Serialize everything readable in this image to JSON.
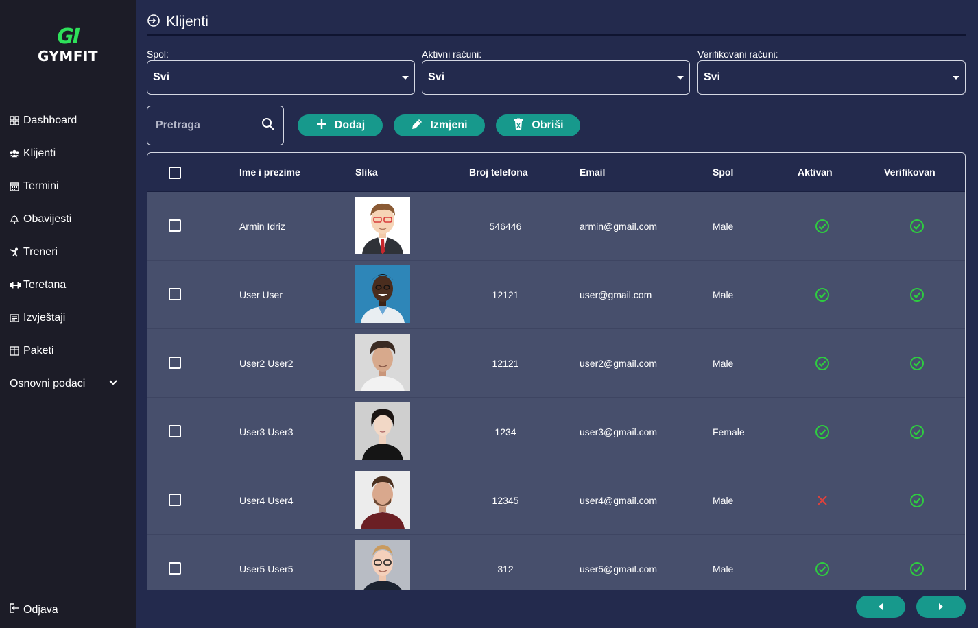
{
  "app": {
    "logo_mark": "GI",
    "logo_text": "GYMFIT"
  },
  "sidebar": {
    "items": [
      {
        "label": "Dashboard",
        "icon": "dashboard-icon"
      },
      {
        "label": "Klijenti",
        "icon": "users-icon"
      },
      {
        "label": "Termini",
        "icon": "calendar-icon"
      },
      {
        "label": "Obavijesti",
        "icon": "bell-icon"
      },
      {
        "label": "Treneri",
        "icon": "trainer-icon"
      },
      {
        "label": "Teretana",
        "icon": "dumbbell-icon"
      },
      {
        "label": "Izvještaji",
        "icon": "report-icon"
      },
      {
        "label": "Paketi",
        "icon": "package-icon"
      }
    ],
    "group_label": "Osnovni podaci",
    "logout_label": "Odjava"
  },
  "header": {
    "title": "Klijenti"
  },
  "filters": [
    {
      "label": "Spol:",
      "value": "Svi"
    },
    {
      "label": "Aktivni računi:",
      "value": "Svi"
    },
    {
      "label": "Verifikovani računi:",
      "value": "Svi"
    }
  ],
  "search": {
    "placeholder": "Pretraga"
  },
  "actions": {
    "add_label": "Dodaj",
    "edit_label": "Izmjeni",
    "delete_label": "Obriši"
  },
  "table": {
    "columns": [
      "Ime i prezime",
      "Slika",
      "Broj telefona",
      "Email",
      "Spol",
      "Aktivan",
      "Verifikovan"
    ],
    "rows": [
      {
        "name": "Armin Idriz",
        "phone": "546446",
        "email": "armin@gmail.com",
        "gender": "Male",
        "active": true,
        "verified": true
      },
      {
        "name": "User User",
        "phone": "12121",
        "email": "user@gmail.com",
        "gender": "Male",
        "active": true,
        "verified": true
      },
      {
        "name": "User2 User2",
        "phone": "12121",
        "email": "user2@gmail.com",
        "gender": "Male",
        "active": true,
        "verified": true
      },
      {
        "name": "User3 User3",
        "phone": "1234",
        "email": "user3@gmail.com",
        "gender": "Female",
        "active": true,
        "verified": true
      },
      {
        "name": "User4 User4",
        "phone": "12345",
        "email": "user4@gmail.com",
        "gender": "Male",
        "active": false,
        "verified": true
      },
      {
        "name": "User5 User5",
        "phone": "312",
        "email": "user5@gmail.com",
        "gender": "Male",
        "active": true,
        "verified": true
      }
    ]
  },
  "colors": {
    "accent": "#17998c",
    "check": "#2ecc40",
    "cross": "#e0413b",
    "logo": "#2ee05a"
  }
}
